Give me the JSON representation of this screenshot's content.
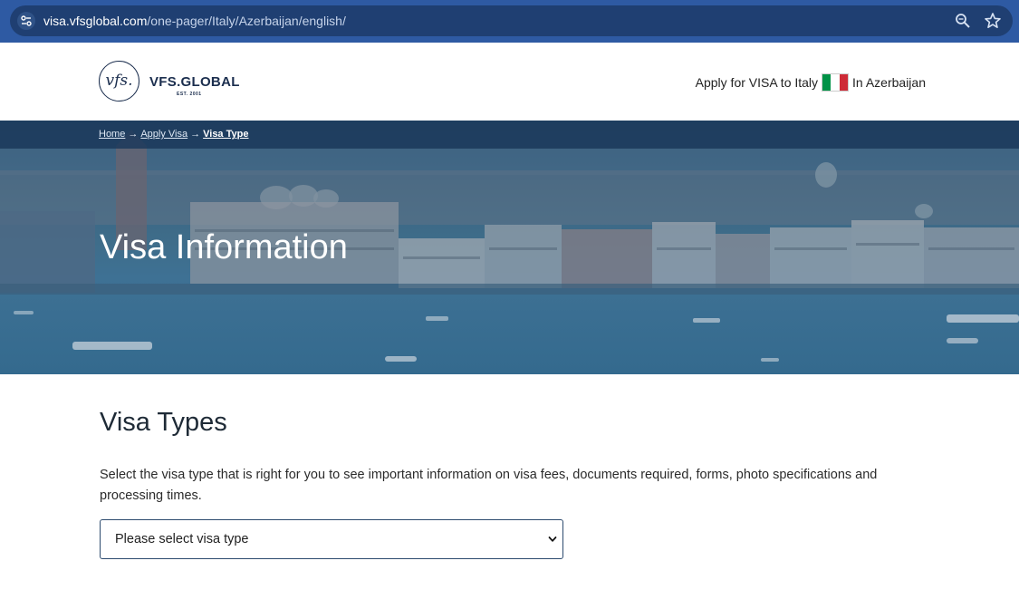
{
  "browser": {
    "url_domain": "visa.vfsglobal.com",
    "url_path": "/one-pager/Italy/Azerbaijan/english/"
  },
  "header": {
    "logo_mark": "vfs.",
    "logo_name": "VFS.GLOBAL",
    "logo_est": "EST. 2001",
    "apply_text": "Apply for VISA to Italy",
    "location_text": "In Azerbaijan",
    "flag_colors": [
      "#009246",
      "#ffffff",
      "#ce2b37"
    ]
  },
  "breadcrumb": {
    "items": [
      "Home",
      "Apply Visa",
      "Visa Type"
    ],
    "separator": "→"
  },
  "hero": {
    "title": "Visa Information"
  },
  "main": {
    "section_title": "Visa Types",
    "description": "Select the visa type that is right for you to see important information on visa fees, documents required, forms, photo specifications and processing times.",
    "select": {
      "value": "Please select visa type"
    }
  },
  "colors": {
    "browser_bar": "#2e5aa3",
    "url_pill": "#1f3f72",
    "brand_navy": "#1b2e4e",
    "breadcrumb_bar": "#1c3a5c"
  }
}
